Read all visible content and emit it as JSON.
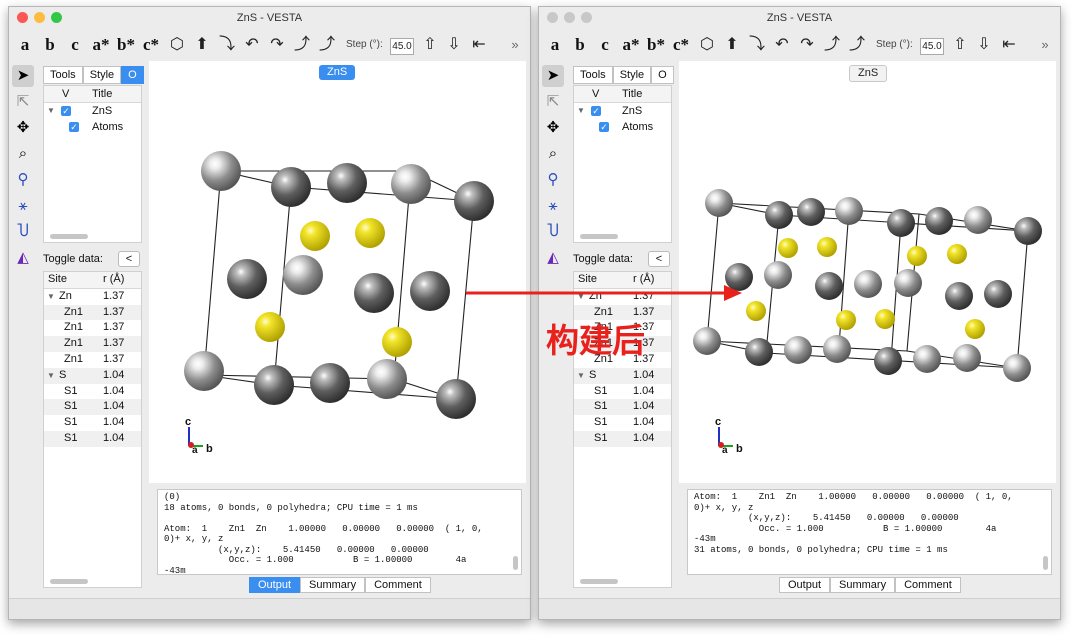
{
  "left_window": {
    "title": "ZnS - VESTA",
    "traffic_colors": [
      "#fc5753",
      "#fdbc40",
      "#33c748"
    ],
    "toolbar": {
      "axis_buttons": [
        "a",
        "b",
        "c",
        "a*",
        "b*",
        "c*"
      ],
      "icons": [
        "polyhedron-icon",
        "rotate-up-icon",
        "rotate-down-icon",
        "rotate-left-icon",
        "rotate-right-icon",
        "rotate-ccw-icon",
        "rotate-cw-icon"
      ],
      "step_label": "Step (°):",
      "step_value": "45.0",
      "more": "»"
    },
    "side_tabs": [
      "Tools",
      "Style",
      "O"
    ],
    "object_table": {
      "headers": [
        "V",
        "Title"
      ],
      "rows": [
        {
          "expander": "▼",
          "label": "ZnS"
        },
        {
          "expander": "",
          "label": "Atoms"
        }
      ]
    },
    "toggle": {
      "label": "Toggle data:",
      "button": "<"
    },
    "site_table": {
      "headers": [
        "Site",
        "r (Å)"
      ],
      "rows": [
        {
          "expander": "▼",
          "site": "Zn",
          "r": "1.37"
        },
        {
          "expander": "",
          "site": "Zn1",
          "r": "1.37"
        },
        {
          "expander": "",
          "site": "Zn1",
          "r": "1.37"
        },
        {
          "expander": "",
          "site": "Zn1",
          "r": "1.37"
        },
        {
          "expander": "",
          "site": "Zn1",
          "r": "1.37"
        },
        {
          "expander": "▼",
          "site": "S",
          "r": "1.04"
        },
        {
          "expander": "",
          "site": "S1",
          "r": "1.04"
        },
        {
          "expander": "",
          "site": "S1",
          "r": "1.04"
        },
        {
          "expander": "",
          "site": "S1",
          "r": "1.04"
        },
        {
          "expander": "",
          "site": "S1",
          "r": "1.04"
        }
      ]
    },
    "viewport": {
      "title": "ZnS",
      "axis_c": "c",
      "axis_a": "a",
      "axis_b": "b"
    },
    "output_text": "(0)\n18 atoms, 0 bonds, 0 polyhedra; CPU time = 1 ms\n\nAtom:  1    Zn1  Zn    1.00000   0.00000   0.00000  ( 1, 0,\n0)+ x, y, z\n          (x,y,z):    5.41450   0.00000   0.00000\n            Occ. = 1.000           B = 1.00000        4a\n-43m",
    "bottom_tabs": [
      "Output",
      "Summary",
      "Comment"
    ]
  },
  "right_window": {
    "title": "ZnS - VESTA",
    "traffic_colors": [
      "#c8c8c8",
      "#c8c8c8",
      "#c8c8c8"
    ],
    "toolbar": {
      "axis_buttons": [
        "a",
        "b",
        "c",
        "a*",
        "b*",
        "c*"
      ],
      "icons": [
        "polyhedron-icon",
        "rotate-up-icon",
        "rotate-down-icon",
        "rotate-left-icon",
        "rotate-right-icon",
        "rotate-ccw-icon",
        "rotate-cw-icon"
      ],
      "step_label": "Step (°):",
      "step_value": "45.0",
      "more": "»"
    },
    "side_tabs": [
      "Tools",
      "Style",
      "O"
    ],
    "object_table": {
      "headers": [
        "V",
        "Title"
      ],
      "rows": [
        {
          "expander": "▼",
          "label": "ZnS"
        },
        {
          "expander": "",
          "label": "Atoms"
        }
      ]
    },
    "toggle": {
      "label": "Toggle data:",
      "button": "<"
    },
    "site_table": {
      "headers": [
        "Site",
        "r (Å)"
      ],
      "rows": [
        {
          "expander": "▼",
          "site": "Zn",
          "r": "1.37"
        },
        {
          "expander": "",
          "site": "Zn1",
          "r": "1.37"
        },
        {
          "expander": "",
          "site": "Zn1",
          "r": "1.37"
        },
        {
          "expander": "",
          "site": "Zn1",
          "r": "1.37"
        },
        {
          "expander": "",
          "site": "Zn1",
          "r": "1.37"
        },
        {
          "expander": "▼",
          "site": "S",
          "r": "1.04"
        },
        {
          "expander": "",
          "site": "S1",
          "r": "1.04"
        },
        {
          "expander": "",
          "site": "S1",
          "r": "1.04"
        },
        {
          "expander": "",
          "site": "S1",
          "r": "1.04"
        },
        {
          "expander": "",
          "site": "S1",
          "r": "1.04"
        }
      ]
    },
    "viewport": {
      "title": "ZnS",
      "axis_c": "c",
      "axis_a": "a",
      "axis_b": "b"
    },
    "output_text": "Atom:  1    Zn1  Zn    1.00000   0.00000   0.00000  ( 1, 0,\n0)+ x, y, z\n          (x,y,z):    5.41450   0.00000   0.00000\n            Occ. = 1.000           B = 1.00000        4a\n-43m\n31 atoms, 0 bonds, 0 polyhedra; CPU time = 1 ms",
    "bottom_tabs": [
      "Output",
      "Summary",
      "Comment"
    ]
  },
  "annotation": {
    "label": "构建后",
    "color": "#e8211d"
  }
}
